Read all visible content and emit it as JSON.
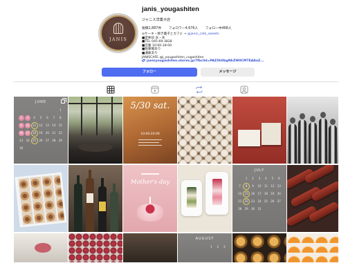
{
  "profile": {
    "username": "janis_yougashiten",
    "display_name": "ジャニス洋菓子店",
    "avatar_logo_text": "JANIS",
    "stats": {
      "posts": "投稿1,887件",
      "followers": "フォロワー4,676人",
      "following": "フォロー中468人"
    },
    "bio": {
      "lines": [
        "◎ケーキ・焼き菓子とカフェ →",
        "■定休日 水・木",
        "■TEL 045-69-3828",
        "■営業 10:00-18:00",
        "■駐車場あり",
        "■通販あり",
        "JANISCAFE @j_yougashiten_cugashiten"
      ],
      "mention": "@janis_cafe_sweets",
      "link": "janisyougashiten.stores.jp/?fbclid=PAZXh0bgNhZW0CMTEAAaZ..."
    }
  },
  "actions": {
    "follow_label": "フォロー",
    "message_label": "メッセージ"
  },
  "tabs": [
    {
      "icon": "grid-icon",
      "active": true
    },
    {
      "icon": "reels-icon",
      "active": false
    },
    {
      "icon": "repost-icon",
      "active": false
    },
    {
      "icon": "tagged-icon",
      "active": false
    }
  ],
  "colors": {
    "accent": "#4f6df0",
    "link": "#3552d4",
    "calendar_pink": "#e68fa8",
    "calendar_yellow": "#e8d36a"
  },
  "grid": {
    "r1c1": {
      "calendar": {
        "title": "JUNE",
        "weeks": [
          [
            "",
            "",
            "",
            "",
            "",
            "",
            "1"
          ],
          [
            "2",
            "3",
            "4",
            "5",
            "6",
            "7",
            "8"
          ],
          [
            "9",
            "10",
            "11",
            "12",
            "13",
            "14",
            "15"
          ],
          [
            "16",
            "17",
            "18",
            "19",
            "20",
            "21",
            "22"
          ],
          [
            "23",
            "24",
            "25",
            "26",
            "27",
            "28",
            "29"
          ],
          [
            "30"
          ]
        ],
        "pink_days": [
          "2",
          "3",
          "9",
          "10",
          "16",
          "17"
        ],
        "yellow_days": [
          "11",
          "18",
          "25"
        ]
      }
    },
    "r1c3": {
      "overlay": "5/30 sat.",
      "subtext": "10:00-20:00"
    },
    "r2c3": {
      "overlay": "Mother's day"
    },
    "r2c5": {
      "calendar": {
        "title": "JULY",
        "weeks": [
          [
            "",
            "1",
            "2",
            "3",
            "4",
            "5",
            "6"
          ],
          [
            "7",
            "8",
            "9",
            "10",
            "11",
            "12",
            "13"
          ],
          [
            "14",
            "15",
            "16",
            "17",
            "18",
            "19",
            "20"
          ],
          [
            "21",
            "22",
            "23",
            "24",
            "25",
            "26",
            "27"
          ],
          [
            "28",
            "29",
            "30",
            "31"
          ]
        ],
        "pink_days": [],
        "yellow_days": [
          "8",
          "15",
          "22"
        ]
      }
    },
    "r3c4": {
      "calendar": {
        "title": "AUGUST",
        "weeks": [
          [
            "",
            "",
            "",
            "",
            "1",
            "2",
            "3"
          ]
        ],
        "pink_days": [],
        "yellow_days": []
      }
    }
  }
}
